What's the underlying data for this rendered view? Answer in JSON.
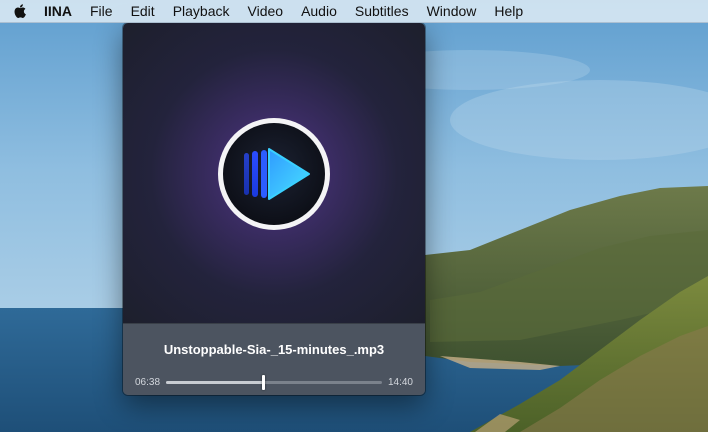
{
  "menubar": {
    "apple_icon": "apple-logo-icon",
    "app_name": "IINA",
    "items": [
      "File",
      "Edit",
      "Playback",
      "Video",
      "Audio",
      "Subtitles",
      "Window",
      "Help"
    ]
  },
  "player": {
    "artwork_icon": "iina-logo-icon",
    "title": "Unstoppable-Sia-_15-minutes_.mp3",
    "time_elapsed": "06:38",
    "time_total": "14:40",
    "progress": 0.4523,
    "colors": {
      "logo_blue": "#1e7bff",
      "logo_cyan": "#3bd4ff",
      "controls_bg": "#4c5460"
    }
  }
}
